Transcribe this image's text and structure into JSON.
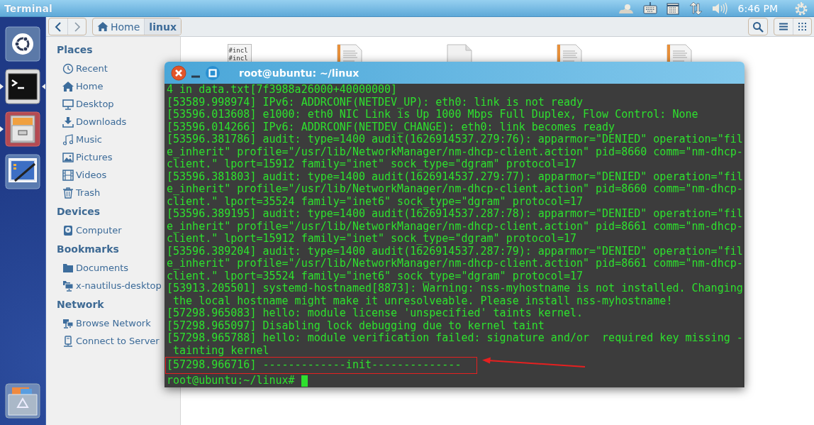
{
  "top_panel": {
    "title": "Terminal",
    "clock": "6:46 PM",
    "indicators": [
      {
        "kind": "weather"
      },
      {
        "kind": "keyboard"
      },
      {
        "kind": "calendar"
      },
      {
        "kind": "network"
      },
      {
        "kind": "volume"
      }
    ]
  },
  "launcher": {
    "items": [
      {
        "kind": "dash",
        "running": false,
        "focused": false
      },
      {
        "kind": "terminal",
        "running": true,
        "focused": true
      },
      {
        "kind": "files",
        "running": true,
        "focused": false
      },
      {
        "kind": "editor",
        "running": false,
        "focused": false
      },
      {
        "kind": "trash",
        "running": false,
        "focused": false
      }
    ]
  },
  "file_manager": {
    "breadcrumb": [
      {
        "label": "Home",
        "selected": false
      },
      {
        "label": "linux",
        "selected": true
      }
    ],
    "sidebar": {
      "sections": [
        {
          "heading": "Places",
          "items": [
            {
              "kind": "recent",
              "label": "Recent"
            },
            {
              "kind": "home",
              "label": "Home"
            },
            {
              "kind": "desktop",
              "label": "Desktop"
            },
            {
              "kind": "downloads",
              "label": "Downloads"
            },
            {
              "kind": "music",
              "label": "Music"
            },
            {
              "kind": "pictures",
              "label": "Pictures"
            },
            {
              "kind": "videos",
              "label": "Videos"
            },
            {
              "kind": "trash",
              "label": "Trash"
            }
          ]
        },
        {
          "heading": "Devices",
          "items": [
            {
              "kind": "drive",
              "label": "Computer"
            }
          ]
        },
        {
          "heading": "Bookmarks",
          "items": [
            {
              "kind": "folder",
              "label": "Documents"
            },
            {
              "kind": "desktop-folder",
              "label": "x-nautilus-desktop"
            }
          ]
        },
        {
          "heading": "Network",
          "items": [
            {
              "kind": "network",
              "label": "Browse Network"
            },
            {
              "kind": "server",
              "label": "Connect to Server"
            }
          ]
        }
      ]
    },
    "files": [
      {
        "kind": "source",
        "preview": [
          "#incl",
          "#incl"
        ]
      },
      {
        "kind": "text"
      },
      {
        "kind": "blank"
      },
      {
        "kind": "text"
      },
      {
        "kind": "text"
      }
    ]
  },
  "terminal": {
    "title": "root@ubuntu: ~/linux",
    "lines": [
      {
        "text": "4 in data.txt[7f3988a26000+40000000]",
        "highlighted": false
      },
      {
        "text": "[53589.998974] IPv6: ADDRCONF(NETDEV_UP): eth0: link is not ready",
        "highlighted": false
      },
      {
        "text": "[53596.013608] e1000: eth0 NIC Link is Up 1000 Mbps Full Duplex, Flow Control: None",
        "highlighted": false
      },
      {
        "text": "[53596.014266] IPv6: ADDRCONF(NETDEV_CHANGE): eth0: link becomes ready",
        "highlighted": false
      },
      {
        "text": "[53596.381786] audit: type=1400 audit(1626914537.279:76): apparmor=\"DENIED\" operation=\"fil",
        "highlighted": false
      },
      {
        "text": "e_inherit\" profile=\"/usr/lib/NetworkManager/nm-dhcp-client.action\" pid=8660 comm=\"nm-dhcp-",
        "highlighted": false
      },
      {
        "text": "client.\" lport=15912 family=\"inet\" sock_type=\"dgram\" protocol=17",
        "highlighted": false
      },
      {
        "text": "[53596.381803] audit: type=1400 audit(1626914537.279:77): apparmor=\"DENIED\" operation=\"fil",
        "highlighted": false
      },
      {
        "text": "e_inherit\" profile=\"/usr/lib/NetworkManager/nm-dhcp-client.action\" pid=8660 comm=\"nm-dhcp-",
        "highlighted": false
      },
      {
        "text": "client.\" lport=35524 family=\"inet6\" sock_type=\"dgram\" protocol=17",
        "highlighted": false
      },
      {
        "text": "[53596.389195] audit: type=1400 audit(1626914537.287:78): apparmor=\"DENIED\" operation=\"fil",
        "highlighted": false
      },
      {
        "text": "e_inherit\" profile=\"/usr/lib/NetworkManager/nm-dhcp-client.action\" pid=8661 comm=\"nm-dhcp-",
        "highlighted": false
      },
      {
        "text": "client.\" lport=15912 family=\"inet\" sock_type=\"dgram\" protocol=17",
        "highlighted": false
      },
      {
        "text": "[53596.389204] audit: type=1400 audit(1626914537.287:79): apparmor=\"DENIED\" operation=\"fil",
        "highlighted": false
      },
      {
        "text": "e_inherit\" profile=\"/usr/lib/NetworkManager/nm-dhcp-client.action\" pid=8661 comm=\"nm-dhcp-",
        "highlighted": false
      },
      {
        "text": "client.\" lport=35524 family=\"inet6\" sock_type=\"dgram\" protocol=17",
        "highlighted": false
      },
      {
        "text": "[53913.205501] systemd-hostnamed[8873]: Warning: nss-myhostname is not installed. Changing",
        "highlighted": false
      },
      {
        "text": " the local hostname might make it unresolveable. Please install nss-myhostname!",
        "highlighted": false
      },
      {
        "text": "[57298.965083] hello: module license 'unspecified' taints kernel.",
        "highlighted": false
      },
      {
        "text": "[57298.965097] Disabling lock debugging due to kernel taint",
        "highlighted": false
      },
      {
        "text": "[57298.965788] hello: module verification failed: signature and/or  required key missing -",
        "highlighted": false
      },
      {
        "text": " tainting kernel",
        "highlighted": false
      },
      {
        "text": "[57298.966716] -------------init--------------",
        "highlighted": true
      }
    ],
    "prompt": "root@ubuntu:~/linux#"
  }
}
